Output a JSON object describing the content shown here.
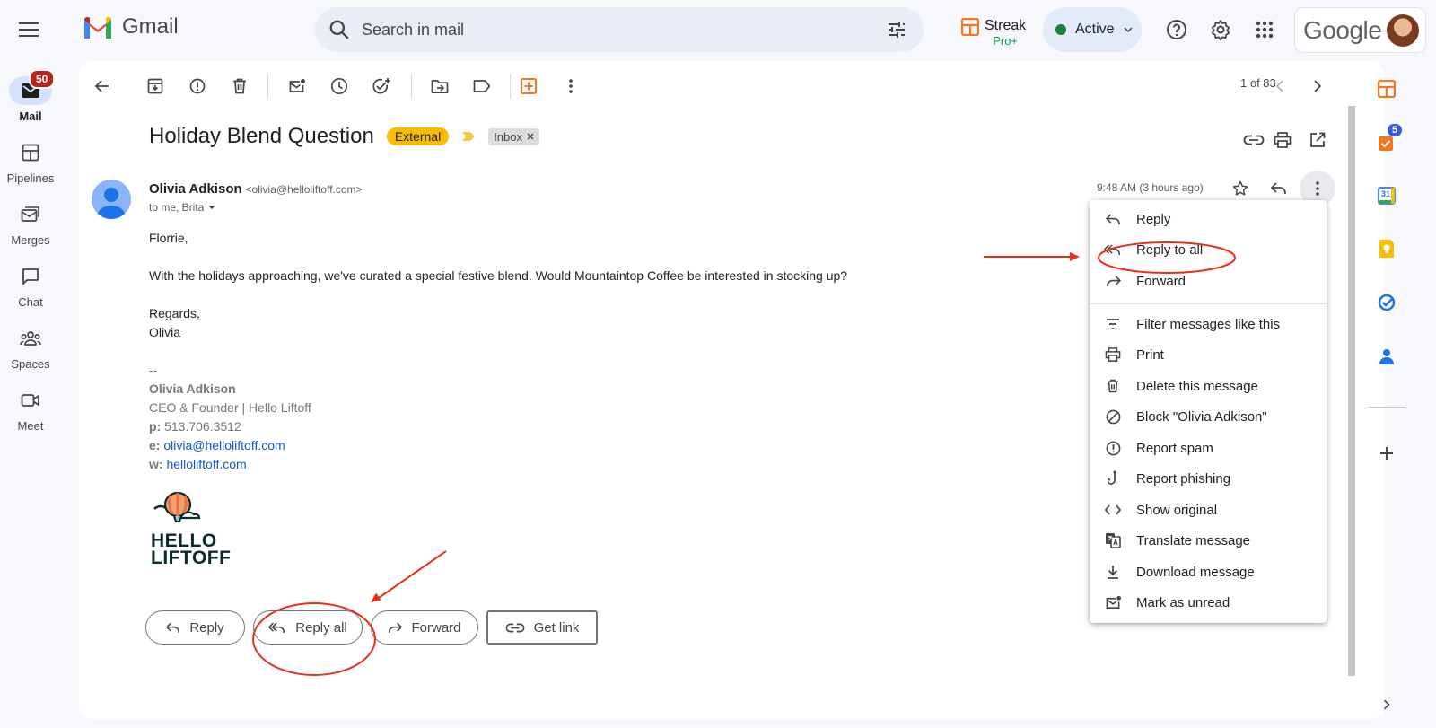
{
  "app": {
    "name": "Gmail"
  },
  "search": {
    "placeholder": "Search in mail"
  },
  "streak": {
    "name": "Streak",
    "tier": "Pro+"
  },
  "status": {
    "label": "Active",
    "color": "#188038"
  },
  "account": {
    "brand": "Google"
  },
  "leftnav": {
    "items": [
      {
        "label": "Mail",
        "icon": "mail-icon",
        "badge": "50",
        "active": true
      },
      {
        "label": "Pipelines",
        "icon": "pipelines-icon"
      },
      {
        "label": "Merges",
        "icon": "merges-icon"
      },
      {
        "label": "Chat",
        "icon": "chat-icon"
      },
      {
        "label": "Spaces",
        "icon": "spaces-icon"
      },
      {
        "label": "Meet",
        "icon": "meet-icon"
      }
    ]
  },
  "toolbar": {
    "pager": "1 of 83"
  },
  "email": {
    "subject": "Holiday Blend Question",
    "external_label": "External",
    "inbox_label": "Inbox",
    "sender_name": "Olivia Adkison",
    "sender_email": "<olivia@helloliftoff.com>",
    "to": "to me, Brita",
    "time": "9:48 AM (3 hours ago)",
    "greeting": "Florrie,",
    "paragraph": "With the holidays approaching, we've curated a special festive blend. Would Mountaintop Coffee be interested in stocking up?",
    "closing": "Regards,",
    "closing_name": "Olivia",
    "signature": {
      "dashes": "--",
      "name": "Olivia Adkison",
      "title": "CEO & Founder | Hello Liftoff",
      "phone_label": "p:",
      "phone": "513.706.3512",
      "email_label": "e:",
      "email": "olivia@helloliftoff.com",
      "web_label": "w:",
      "web": "helloliftoff.com"
    },
    "logo_line1": "HELLO",
    "logo_line2": "LIFTOFF"
  },
  "actions": {
    "reply": "Reply",
    "reply_all": "Reply all",
    "forward": "Forward",
    "get_link": "Get link"
  },
  "menu": {
    "items": [
      {
        "label": "Reply",
        "icon": "reply-icon"
      },
      {
        "label": "Reply to all",
        "icon": "reply-all-icon"
      },
      {
        "label": "Forward",
        "icon": "forward-icon"
      },
      {
        "label": "Filter messages like this",
        "icon": "filter-icon"
      },
      {
        "label": "Print",
        "icon": "print-icon"
      },
      {
        "label": "Delete this message",
        "icon": "trash-icon"
      },
      {
        "label": "Block \"Olivia Adkison\"",
        "icon": "block-icon"
      },
      {
        "label": "Report spam",
        "icon": "spam-icon"
      },
      {
        "label": "Report phishing",
        "icon": "phishing-icon"
      },
      {
        "label": "Show original",
        "icon": "code-icon"
      },
      {
        "label": "Translate message",
        "icon": "translate-icon"
      },
      {
        "label": "Download message",
        "icon": "download-icon"
      },
      {
        "label": "Mark as unread",
        "icon": "mark-unread-icon"
      }
    ]
  },
  "rail": {
    "tasks_badge": "5",
    "calendar_day": "31"
  },
  "colors": {
    "accent": "#0b57d0",
    "annotation": "#e8311a",
    "external": "#fbbc04"
  }
}
